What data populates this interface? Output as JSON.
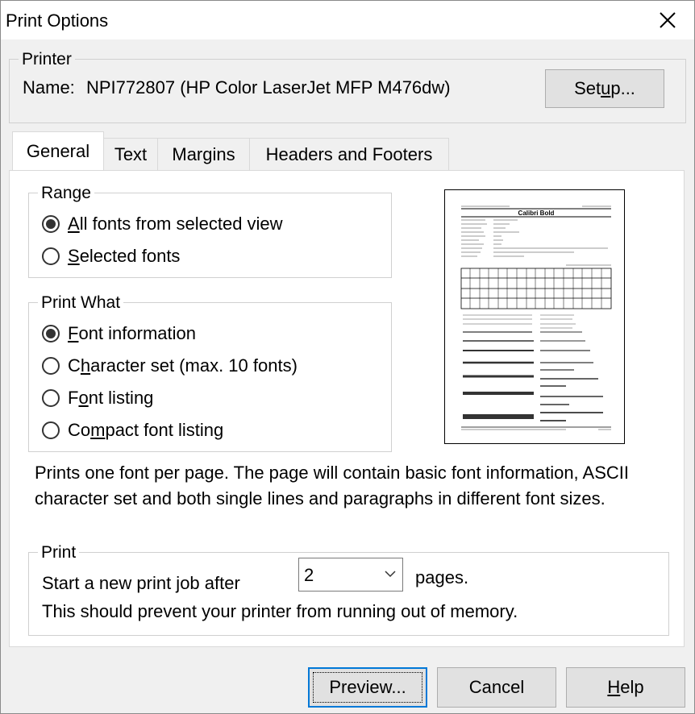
{
  "window": {
    "title": "Print Options"
  },
  "printer": {
    "group_label": "Printer",
    "name_label": "Name:",
    "name_value": "NPI772807 (HP Color LaserJet MFP M476dw)",
    "setup_button": {
      "pre": "Set",
      "u": "u",
      "post": "p..."
    }
  },
  "tabs": [
    {
      "label": "General",
      "active": true
    },
    {
      "label": "Text"
    },
    {
      "label": "Margins"
    },
    {
      "label": "Headers and Footers"
    }
  ],
  "range": {
    "group_label": "Range",
    "options": [
      {
        "u": "A",
        "rest": "ll fonts from selected view",
        "selected": true
      },
      {
        "u": "S",
        "rest": "elected fonts",
        "selected": false
      }
    ]
  },
  "print_what": {
    "group_label": "Print What",
    "options": [
      {
        "pre": "",
        "u": "F",
        "rest": "ont information",
        "selected": true
      },
      {
        "pre": "C",
        "u": "h",
        "rest": "aracter set (max. 10 fonts)",
        "selected": false
      },
      {
        "pre": "F",
        "u": "o",
        "rest": "nt listing",
        "selected": false
      },
      {
        "pre": "Co",
        "u": "m",
        "rest": "pact font listing",
        "selected": false
      }
    ]
  },
  "description": "Prints one font per page. The page will contain basic font information, ASCII character set and both single lines and paragraphs in different font sizes.",
  "print_group": {
    "group_label": "Print",
    "start_label": "Start a new print job after",
    "pages_value": "2",
    "pages_label": "pages.",
    "note": "This should prevent your printer from running out of memory."
  },
  "preview_page": {
    "font_title": "Calibri Bold"
  },
  "buttons": {
    "preview": {
      "label": "Preview..."
    },
    "cancel": {
      "label": "Cancel"
    },
    "help": {
      "u": "H",
      "rest": "elp"
    }
  }
}
